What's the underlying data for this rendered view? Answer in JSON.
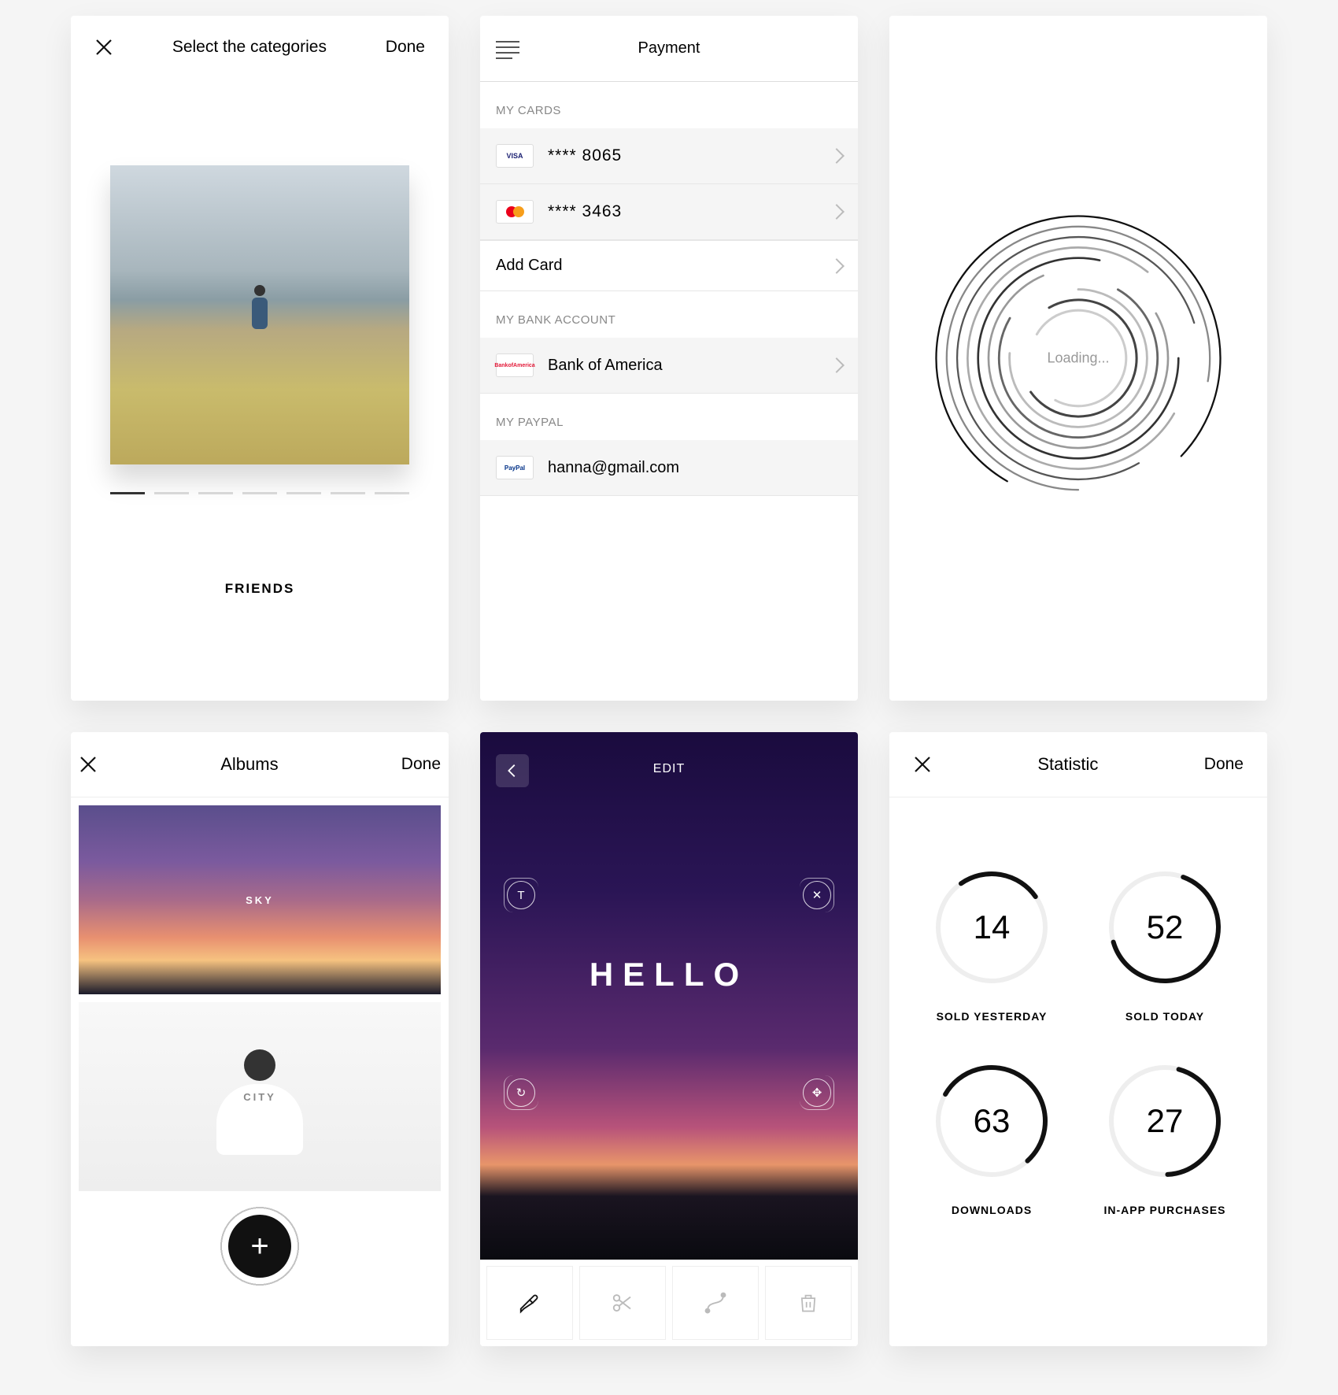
{
  "categories": {
    "title": "Select the categories",
    "done": "Done",
    "label": "FRIENDS",
    "pager_total": 7,
    "pager_active": 0
  },
  "albums": {
    "title": "Albums",
    "done": "Done",
    "items": [
      {
        "label": "SKY"
      },
      {
        "label": "CITY"
      }
    ]
  },
  "payment": {
    "title": "Payment",
    "sections": {
      "cards": {
        "label": "MY CARDS",
        "items": [
          {
            "brand": "VISA",
            "text": "**** 8065"
          },
          {
            "brand": "MC",
            "text": "**** 3463"
          }
        ],
        "add": "Add Card"
      },
      "bank": {
        "label": "MY BANK ACCOUNT",
        "items": [
          {
            "brand": "BOA",
            "text": "Bank of America"
          }
        ]
      },
      "paypal": {
        "label": "MY PAYPAL",
        "items": [
          {
            "brand": "PAYPAL",
            "text": "hanna@gmail.com"
          }
        ]
      }
    }
  },
  "edit": {
    "title": "EDIT",
    "overlay": "HELLO",
    "corner_tools": {
      "tl": "T",
      "tr": "✕",
      "bl": "↻",
      "br": "✥"
    },
    "toolbar": [
      "paint",
      "cut",
      "curve",
      "trash"
    ]
  },
  "loading": {
    "text": "Loading..."
  },
  "statistic": {
    "title": "Statistic",
    "done": "Done",
    "cells": [
      {
        "value": "14",
        "label": "SOLD YESTERDAY",
        "pct": 25,
        "offset": 325
      },
      {
        "value": "52",
        "label": "SOLD TODAY",
        "pct": 65,
        "offset": 20
      },
      {
        "value": "63",
        "label": "DOWNLOADS",
        "pct": 55,
        "offset": 300
      },
      {
        "value": "27",
        "label": "IN-APP PURCHASES",
        "pct": 45,
        "offset": 15
      }
    ]
  },
  "chart_data": [
    {
      "type": "pie",
      "title": "SOLD YESTERDAY",
      "values": [
        14
      ],
      "completion_pct": 25
    },
    {
      "type": "pie",
      "title": "SOLD TODAY",
      "values": [
        52
      ],
      "completion_pct": 65
    },
    {
      "type": "pie",
      "title": "DOWNLOADS",
      "values": [
        63
      ],
      "completion_pct": 55
    },
    {
      "type": "pie",
      "title": "IN-APP PURCHASES",
      "values": [
        27
      ],
      "completion_pct": 45
    }
  ]
}
